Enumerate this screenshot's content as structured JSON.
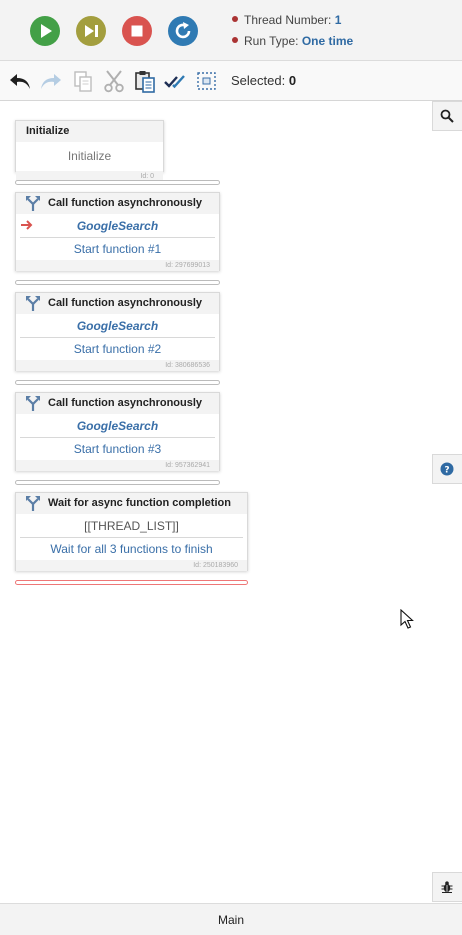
{
  "run_panel": {
    "thread_number_label": "Thread Number:",
    "thread_number_value": "1",
    "run_type_label": "Run Type:",
    "run_type_value": "One time"
  },
  "toolbar": {
    "selected_label": "Selected:",
    "selected_count": "0"
  },
  "nodes": {
    "init": {
      "header": "Initialize",
      "body": "Initialize",
      "id": "Id: 0"
    },
    "call1": {
      "header": "Call function asynchronously",
      "line1": "GoogleSearch",
      "line2": "Start function #1",
      "id": "Id: 297699013"
    },
    "call2": {
      "header": "Call function asynchronously",
      "line1": "GoogleSearch",
      "line2": "Start function #2",
      "id": "Id: 380686536"
    },
    "call3": {
      "header": "Call function asynchronously",
      "line1": "GoogleSearch",
      "line2": "Start function #3",
      "id": "Id: 957362941"
    },
    "wait": {
      "header": "Wait for async function completion",
      "line1": "[[THREAD_LIST]]",
      "line2": "Wait for all 3 functions to finish",
      "id": "Id: 250183960"
    }
  },
  "footer": {
    "label": "Main"
  },
  "icons": {
    "play": "play-icon",
    "step": "step-icon",
    "stop": "stop-icon",
    "restart": "restart-icon",
    "undo": "undo-icon",
    "redo": "redo-icon",
    "copy": "copy-icon",
    "cut": "cut-icon",
    "paste": "paste-icon",
    "select_all": "check-all-icon",
    "deselect": "select-box-icon",
    "search": "search-icon",
    "help": "help-icon",
    "debug": "bug-icon",
    "current_step": "arrow-right-icon",
    "fork": "fork-icon"
  },
  "colors": {
    "play": "#43a047",
    "step": "#a39e3e",
    "stop": "#d9534f",
    "restart": "#2f7ab3",
    "link": "#3a6fa8",
    "current_arrow": "#d9534f"
  }
}
